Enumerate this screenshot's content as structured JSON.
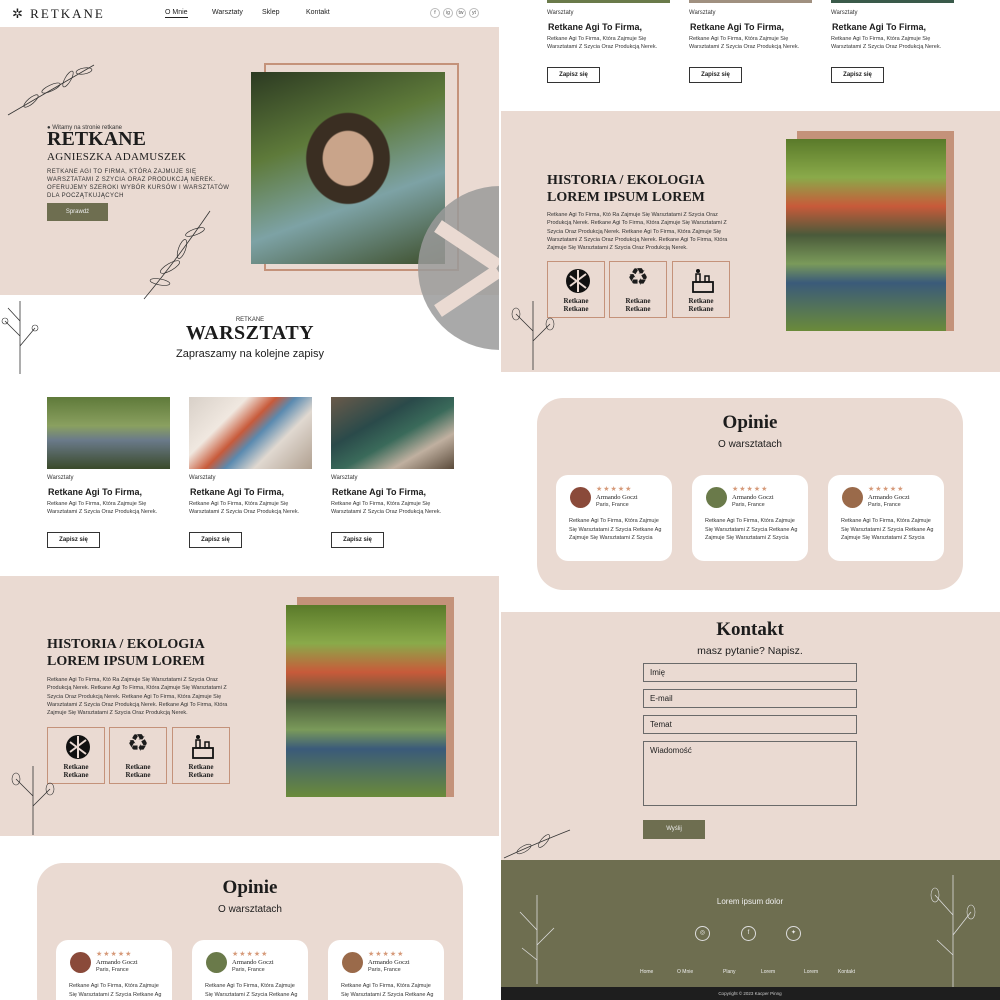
{
  "nav": {
    "logo": "RETKANE",
    "links": [
      "O Mnie",
      "Warsztaty",
      "Sklep",
      "Kontakt"
    ],
    "social": [
      "f",
      "ig",
      "tw",
      "yt"
    ]
  },
  "hero": {
    "kicker": "Witamy na stronie retkane",
    "title": "RETKANE",
    "name": "AGNIESZKA ADAMUSZEK",
    "desc": "RETKANE AGI TO FIRMA, KTÓRA ZAJMUJE SIĘ WARSZTATAMI Z SZYCIA ORAZ PRODUKCJĄ NEREK. OFERUJEMY SZEROKI WYBÓR KURSÓW I WARSZTATÓW DLA POCZĄTKUJĄCYCH",
    "button": "Sprawdź"
  },
  "workshops": {
    "kicker": "RETKANE",
    "title": "WARSZTATY",
    "subtitle": "Zapraszamy na kolejne zapisy",
    "cards": [
      {
        "category": "Warsztaty",
        "title": "Retkane Agi To Firma,",
        "body": "Retkane Agi To Firma, Która Zajmuje Się Warsztatami Z Szycia Oraz Produkcją Nerek.",
        "button": "Zapisz się"
      },
      {
        "category": "Warsztaty",
        "title": "Retkane Agi To Firma,",
        "body": "Retkane Agi To Firma, Która Zajmuje Się Warsztatami Z Szycia Oraz Produkcją Nerek.",
        "button": "Zapisz się"
      },
      {
        "category": "Warsztaty",
        "title": "Retkane Agi To Firma,",
        "body": "Retkane Agi To Firma, Która Zajmuje Się Warsztatami Z Szycia Oraz Produkcją Nerek.",
        "button": "Zapisz się"
      }
    ]
  },
  "history": {
    "title_line1": "HISTORIA / EKOLOGIA",
    "title_line2": "LOREM IPSUM LOREM",
    "body": "Retkane Agi To Firma, Któ Ra Zajmuje Się Warsztatami Z Szycia Oraz Produkcją Nerek. Retkane Agi To Firma, Która Zajmuje Się Warsztatami Z Szycia Oraz Produkcją Nerek. Retkane Agi To Firma, Która Zajmuje Się Warsztatami Z Szycia Oraz Produkcją Nerek. Retkane Agi To Firma, Która Zajmuje Się Warsztatami Z Szycia Oraz Produkcją Nerek.",
    "icon_labels": [
      "Retkane",
      "Retkane"
    ]
  },
  "reviews": {
    "title": "Opinie",
    "subtitle": "O warsztatach",
    "stars": "★★★★★",
    "items": [
      {
        "name": "Armando Goczi",
        "location": "Paris, France",
        "text": "Retkane Agi To Firma, Która Zajmuje Się Warsztatami Z Szycia  Retkane Ag Zajmuje Się Warsztatami Z Szycia",
        "avatar_color": "#8a4a3a"
      },
      {
        "name": "Armando Goczi",
        "location": "Paris, France",
        "text": "Retkane Agi To Firma, Która Zajmuje Się Warsztatami Z Szycia  Retkane Ag Zajmuje Się Warsztatami Z Szycia",
        "avatar_color": "#6a7a4a"
      },
      {
        "name": "Armando Goczi",
        "location": "Paris, France",
        "text": "Retkane Agi To Firma, Która Zajmuje Się Warsztatami Z Szycia  Retkane Ag Zajmuje Się Warsztatami Z Szycia",
        "avatar_color": "#9a6a4a"
      }
    ]
  },
  "contact": {
    "title": "Kontakt",
    "subtitle": "masz pytanie? Napisz.",
    "fields": [
      "Imię",
      "E-mail",
      "Temat",
      "Wiadomość"
    ],
    "button": "Wyślij"
  },
  "footer": {
    "title": "Lorem ipsum dolor",
    "links": [
      "Home",
      "O Mnie",
      "Plany",
      "Lorem",
      "Lorem",
      "Kontakt"
    ],
    "copyright": "Copyright © 2023 Kacper Pinng"
  },
  "colors": {
    "pink": "#eadad2",
    "olive": "#6e6e50",
    "accent": "#c4927a"
  }
}
